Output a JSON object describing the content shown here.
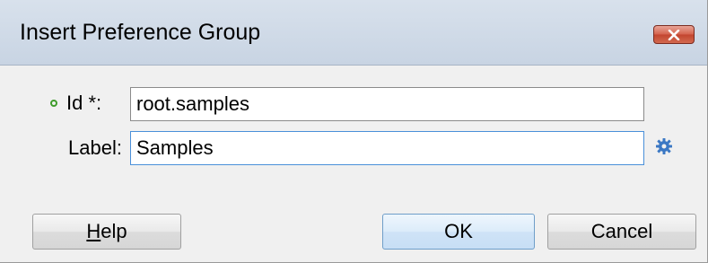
{
  "window": {
    "title": "Insert Preference Group",
    "close_icon": "close-icon"
  },
  "form": {
    "id_label": "Id *:",
    "id_value": "root.samples",
    "label_label": "Label:",
    "label_value": "Samples",
    "required_icon": "required-indicator-icon",
    "gear_icon": "gear-icon"
  },
  "buttons": {
    "help_mnemonic": "H",
    "help_rest": "elp",
    "ok": "OK",
    "cancel": "Cancel"
  },
  "colors": {
    "required": "#3f9c2c",
    "focus_border": "#4a90d9",
    "close_button": "#c2452f"
  }
}
